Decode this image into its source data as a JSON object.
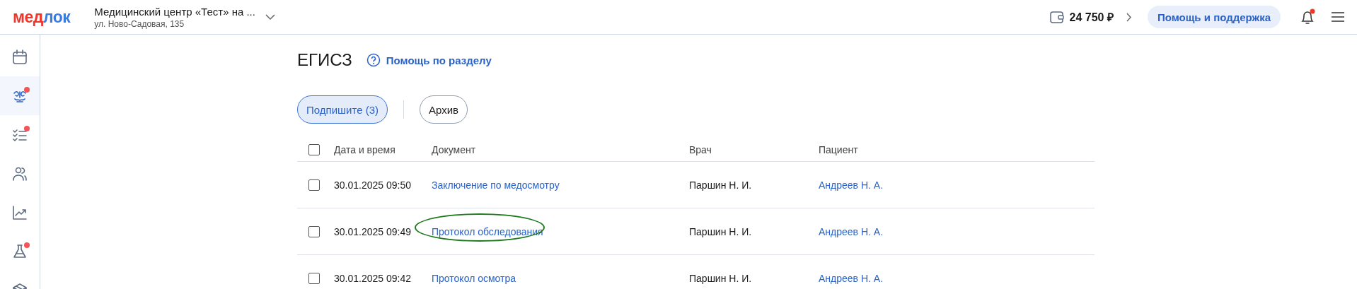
{
  "header": {
    "logo": [
      {
        "text": "мед",
        "color": "#f0352b"
      },
      {
        "text": "лок",
        "color": "#3a7be0"
      }
    ],
    "clinic": {
      "name": "Медицинский центр «Тест» на ...",
      "address": "ул. Ново-Садовая, 135"
    },
    "balance": "24 750 ₽",
    "help_button": "Помощь и поддержка",
    "notifications": {
      "unread": true
    }
  },
  "sidebar": {
    "items": [
      {
        "kind": "calendar",
        "selected": false,
        "dot": false
      },
      {
        "kind": "egisz",
        "selected": true,
        "dot": true
      },
      {
        "kind": "tasks",
        "selected": false,
        "dot": true
      },
      {
        "kind": "people",
        "selected": false,
        "dot": false
      },
      {
        "kind": "chart",
        "selected": false,
        "dot": false
      },
      {
        "kind": "flask",
        "selected": false,
        "dot": true
      },
      {
        "kind": "box",
        "selected": false,
        "dot": false
      }
    ]
  },
  "page": {
    "title": "ЕГИСЗ",
    "help_link": "Помощь по разделу",
    "tabs": [
      {
        "label": "Подпишите (3)",
        "selected": true
      },
      {
        "label": "Архив",
        "selected": false
      }
    ],
    "table": {
      "select_all": false,
      "columns": [
        "Дата и время",
        "Документ",
        "Врач",
        "Пациент"
      ],
      "rows": [
        {
          "checked": false,
          "datetime": "30.01.2025 09:50",
          "document": "Заключение по медосмотру",
          "doctor": "Паршин Н. И.",
          "patient": "Андреев Н. А.",
          "circled": false
        },
        {
          "checked": false,
          "datetime": "30.01.2025 09:49",
          "document": "Протокол обследования",
          "doctor": "Паршин Н. И.",
          "patient": "Андреев Н. А.",
          "circled": true
        },
        {
          "checked": false,
          "datetime": "30.01.2025 09:42",
          "document": "Протокол осмотра",
          "doctor": "Паршин Н. И.",
          "patient": "Андреев Н. А.",
          "circled": false
        }
      ]
    }
  }
}
